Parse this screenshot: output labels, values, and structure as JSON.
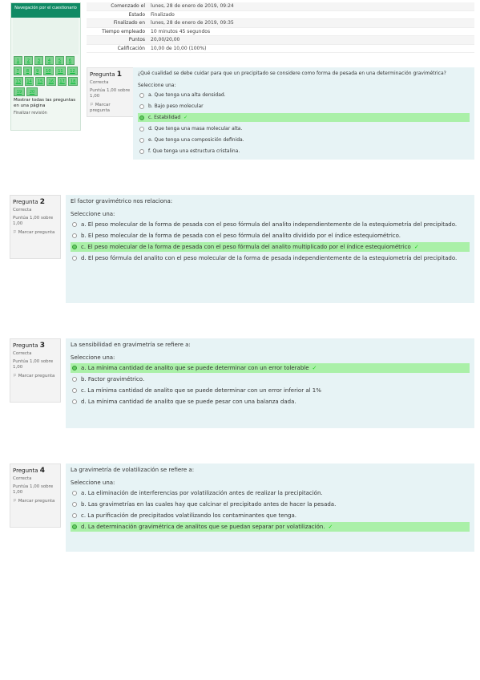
{
  "nav": {
    "title": "Navegación por el cuestionario",
    "buttons": [
      "1",
      "2",
      "3",
      "4",
      "5",
      "6",
      "7",
      "8",
      "9",
      "10",
      "11",
      "12",
      "13",
      "14",
      "15",
      "16",
      "17",
      "18",
      "19",
      "20"
    ],
    "show_all": "Mostrar todas las preguntas en una página",
    "finish": "Finalizar revisión"
  },
  "summary": [
    {
      "label": "Comenzado el",
      "value": "lunes, 28 de enero de 2019, 09:24"
    },
    {
      "label": "Estado",
      "value": "Finalizado"
    },
    {
      "label": "Finalizado en",
      "value": "lunes, 28 de enero de 2019, 09:35"
    },
    {
      "label": "Tiempo empleado",
      "value": "10 minutos 45 segundos"
    },
    {
      "label": "Puntos",
      "value": "20,00/20,00"
    },
    {
      "label": "Calificación",
      "value": "10,00 de 10,00 (100%)"
    }
  ],
  "questions": [
    {
      "label": "Pregunta",
      "number": "1",
      "state": "Correcta",
      "points": "Puntúa 1,00 sobre 1,00",
      "flag": "Marcar pregunta",
      "text": "¿Qué cualidad se debe cuidar para que un precipitado se considere como forma de pesada en una determinación gravimétrica?",
      "select": "Seleccione una:",
      "options": [
        {
          "text": "a. Que tenga una alta densidad.",
          "correct": false
        },
        {
          "text": "b. Bajo peso molecular",
          "correct": false
        },
        {
          "text": "c. Estabilidad",
          "correct": true
        },
        {
          "text": "d. Que tenga una masa molecular alta.",
          "correct": false
        },
        {
          "text": "e. Que tenga una composición definida.",
          "correct": false
        },
        {
          "text": "f. Que tenga una estructura cristalina.",
          "correct": false
        }
      ]
    },
    {
      "label": "Pregunta",
      "number": "2",
      "state": "Correcta",
      "points": "Puntúa 1,00 sobre 1,00",
      "flag": "Marcar pregunta",
      "text": "El factor gravimétrico nos relaciona:",
      "select": "Seleccione una:",
      "options": [
        {
          "text": "a. El peso molecular de la forma de pesada con el peso fórmula del analito independientemente de la estequiometría del precipitado.",
          "correct": false
        },
        {
          "text": "b. El peso molecular de la forma de pesada con el peso fórmula del analito dividido por el índice estequiométrico.",
          "correct": false
        },
        {
          "text": "c. El peso molecular de la forma de pesada con el peso fórmula del analito multiplicado por el índice estequiométrico",
          "correct": true
        },
        {
          "text": "d. El peso fórmula del analito con el peso molecular de la forma de pesada independientemente de la estequiometría del precipitado.",
          "correct": false
        }
      ]
    },
    {
      "label": "Pregunta",
      "number": "3",
      "state": "Correcta",
      "points": "Puntúa 1,00 sobre 1,00",
      "flag": "Marcar pregunta",
      "text": "La sensibilidad en gravimetría se refiere a:",
      "select": "Seleccione una:",
      "options": [
        {
          "text": "a. La mínima cantidad de analito que se puede determinar con un error tolerable",
          "correct": true
        },
        {
          "text": "b. Factor gravimétrico.",
          "correct": false
        },
        {
          "text": "c. La mínima cantidad de analito que se puede determinar con un error inferior al 1%",
          "correct": false
        },
        {
          "text": "d. La mínima cantidad de analito que se puede pesar con una balanza dada.",
          "correct": false
        }
      ]
    },
    {
      "label": "Pregunta",
      "number": "4",
      "state": "Correcta",
      "points": "Puntúa 1,00 sobre 1,00",
      "flag": "Marcar pregunta",
      "text": "La gravimetría de volatilización se refiere a:",
      "select": "Seleccione una:",
      "options": [
        {
          "text": "a. La eliminación de interferencias por volatilización antes de realizar la precipitación.",
          "correct": false
        },
        {
          "text": "b. Las gravimetrías en las cuales hay que calcinar el precipitado antes de hacer la pesada.",
          "correct": false
        },
        {
          "text": "c. La purificación de precipitados volatilizando los contaminantes que tenga.",
          "correct": false
        },
        {
          "text": "d. La determinación gravimétrica de analitos que se puedan separar por volatilización.",
          "correct": true
        }
      ]
    }
  ],
  "colors": {
    "nav_header": "#108a64",
    "correct_bg": "#aaf0a8",
    "question_bg": "#e7f3f5"
  }
}
